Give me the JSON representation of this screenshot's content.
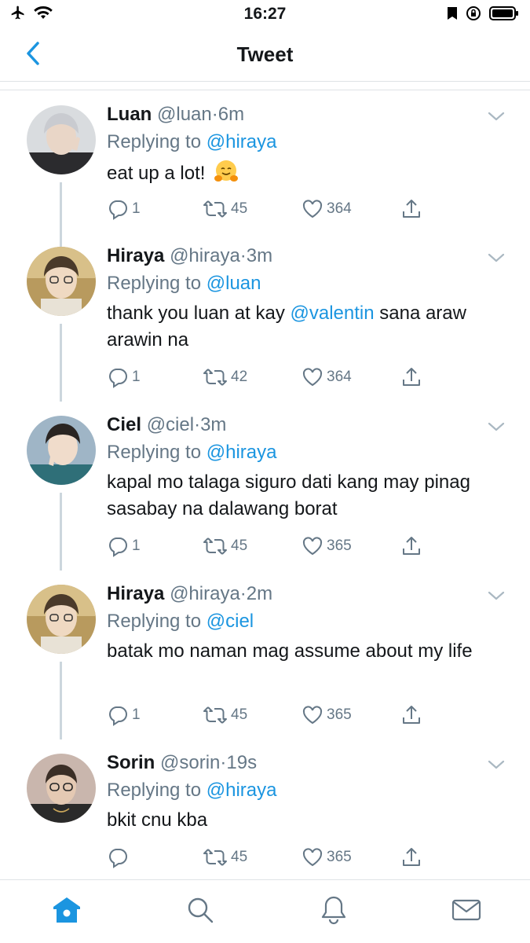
{
  "status_bar": {
    "time": "16:27"
  },
  "nav": {
    "title": "Tweet"
  },
  "tweets": [
    {
      "name": "Luan",
      "handle": "@luan",
      "dot": "·",
      "time": "6m",
      "reply_prefix": "Replying to",
      "reply_to": "@hiraya",
      "text_parts": [
        {
          "t": "eat up a lot!"
        }
      ],
      "emoji": "hugging-face",
      "replies": "1",
      "retweets": "45",
      "likes": "364"
    },
    {
      "name": "Hiraya",
      "handle": "@hiraya",
      "dot": "·",
      "time": "3m",
      "reply_prefix": "Replying to",
      "reply_to": "@luan",
      "text_before": "thank you luan at kay ",
      "text_mention": "@valentin",
      "text_after": " sana araw arawin na",
      "replies": "1",
      "retweets": "42",
      "likes": "364"
    },
    {
      "name": "Ciel",
      "handle": "@ciel",
      "dot": "·",
      "time": "3m",
      "reply_prefix": "Replying to",
      "reply_to": "@hiraya",
      "text": "kapal mo talaga siguro dati kang may pinag sasabay na dalawang borat",
      "replies": "1",
      "retweets": "45",
      "likes": "365"
    },
    {
      "name": "Hiraya",
      "handle": "@hiraya",
      "dot": "·",
      "time": "2m",
      "reply_prefix": "Replying to",
      "reply_to": "@ciel",
      "text": "batak mo naman mag assume about my life",
      "replies": "1",
      "retweets": "45",
      "likes": "365"
    },
    {
      "name": "Sorin",
      "handle": "@sorin",
      "dot": "·",
      "time": "19s",
      "reply_prefix": "Replying to",
      "reply_to": "@hiraya",
      "text": "bkit cnu kba",
      "replies": "",
      "retweets": "45",
      "likes": "365"
    }
  ],
  "colors": {
    "accent": "#1b95e0",
    "muted": "#657786",
    "text": "#14171a",
    "thread_line": "#ccd6dd"
  },
  "icons": [
    "airplane-icon",
    "wifi-icon",
    "bookmark-icon",
    "rotation-lock-icon",
    "battery-icon",
    "back-chevron-icon",
    "reply-icon",
    "retweet-icon",
    "like-icon",
    "share-icon",
    "home-icon",
    "search-icon",
    "notifications-icon",
    "messages-icon"
  ]
}
